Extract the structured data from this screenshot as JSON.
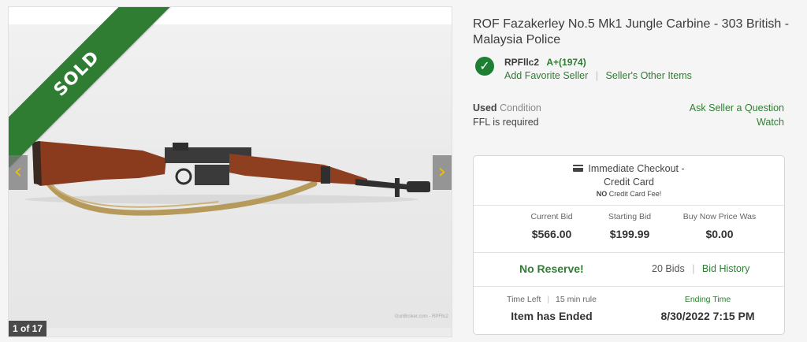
{
  "listing": {
    "title": "ROF Fazakerley No.5 Mk1 Jungle Carbine - 303 British - Malaysia Police",
    "status_ribbon": "SOLD"
  },
  "gallery": {
    "counter": "1 of 17",
    "watermark": "GunBroker.com - RPFllc2",
    "prev_icon": "chevron-left-icon",
    "next_icon": "chevron-right-icon"
  },
  "seller": {
    "name": "RPFllc2",
    "rating": "A+(1974)",
    "add_favorite": "Add Favorite Seller",
    "other_items": "Seller's Other Items",
    "verified_icon": "check-circle-icon",
    "verified_color": "#1e7f34"
  },
  "condition": {
    "value": "Used",
    "label": "Condition",
    "ffl": "FFL is required"
  },
  "actions": {
    "ask_seller": "Ask Seller a Question",
    "watch": "Watch"
  },
  "checkout": {
    "icon": "credit-card-icon",
    "line1": "Immediate Checkout -",
    "line2": "Credit Card",
    "fee_no": "NO",
    "fee_text": "Credit Card Fee!"
  },
  "bids": {
    "current_label": "Current Bid",
    "current_value": "$566.00",
    "starting_label": "Starting Bid",
    "starting_value": "$199.99",
    "buynow_label": "Buy Now Price Was",
    "buynow_value": "$0.00"
  },
  "reserve": {
    "text": "No Reserve!",
    "bid_count": "20 Bids",
    "history": "Bid History"
  },
  "timing": {
    "time_left_label": "Time Left",
    "rule": "15 min rule",
    "status": "Item has Ended",
    "ending_label": "Ending Time",
    "ending_value": "8/30/2022 7:15 PM"
  },
  "colors": {
    "accent_green": "#2f7d32",
    "nav_arrow": "#f0c000"
  }
}
